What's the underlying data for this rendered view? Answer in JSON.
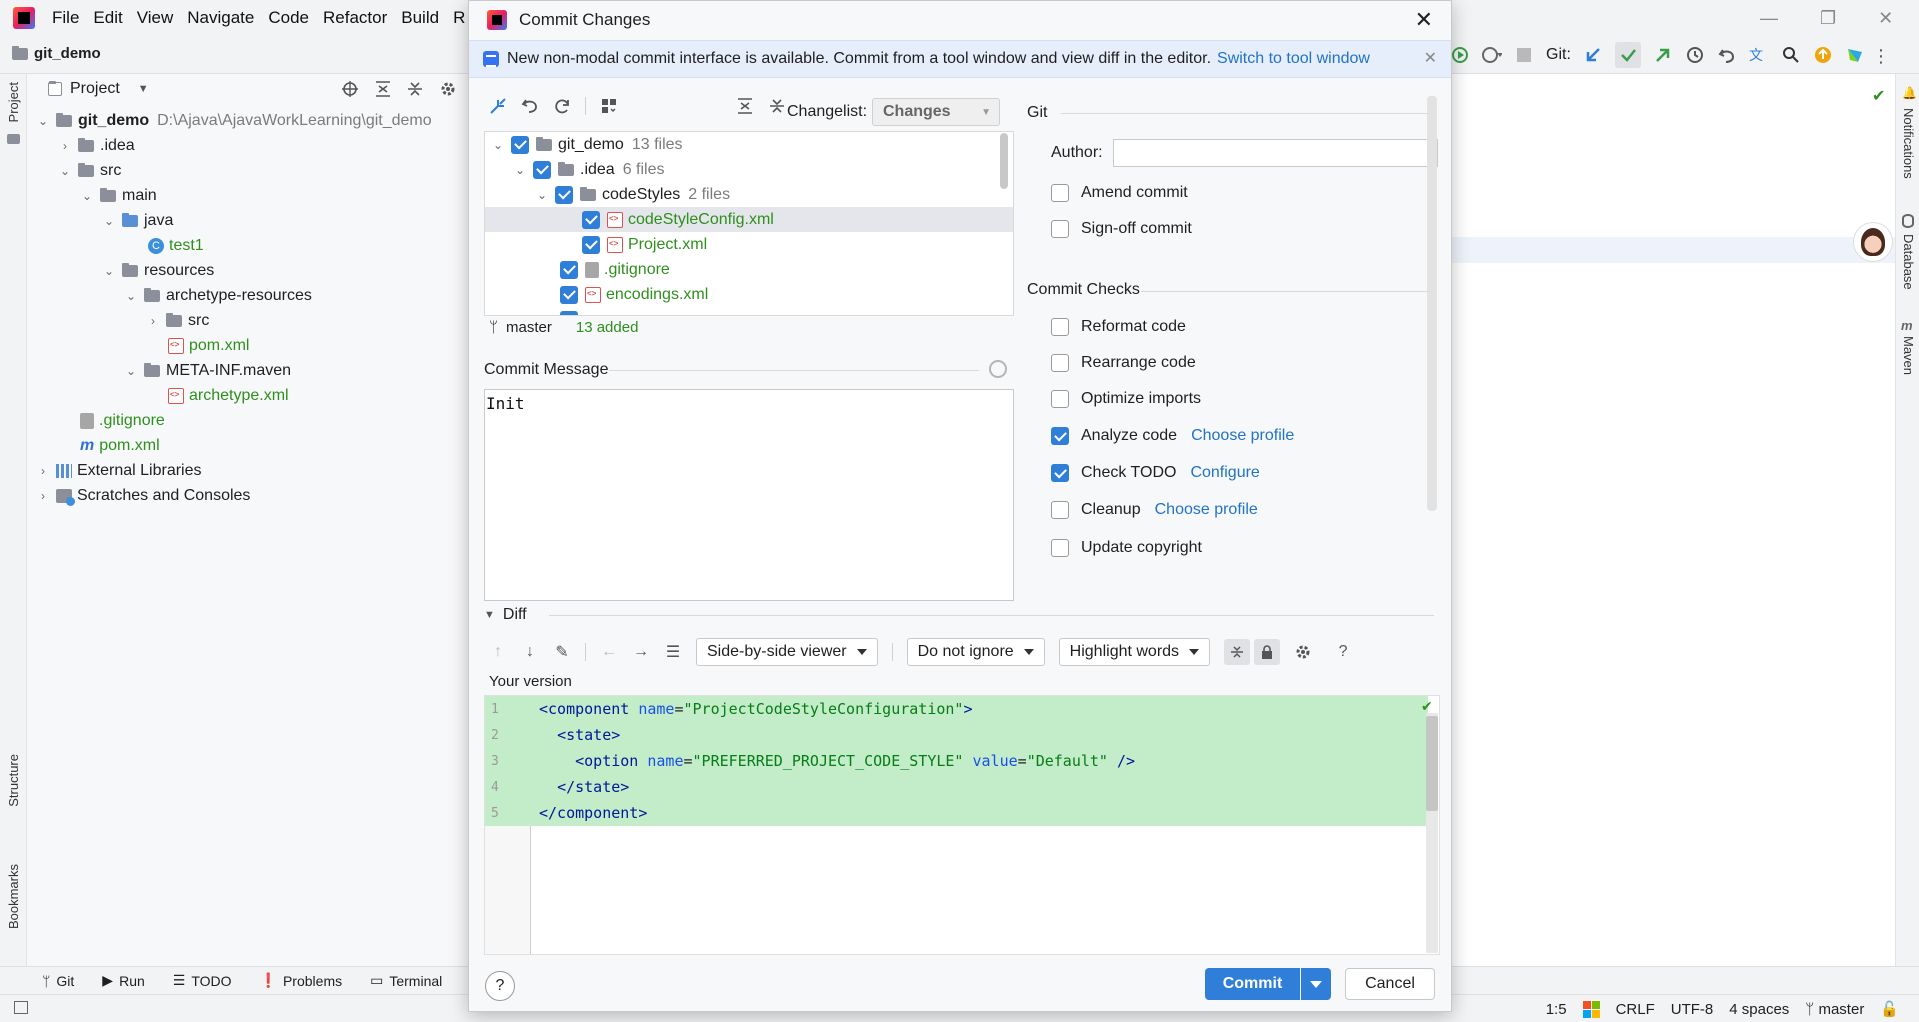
{
  "menu": [
    "File",
    "Edit",
    "View",
    "Navigate",
    "Code",
    "Refactor",
    "Build",
    "R"
  ],
  "navbar": {
    "project_name": "git_demo",
    "vcs_label": "Git:"
  },
  "left_stripe": {
    "project": "Project",
    "structure": "Structure",
    "bookmarks": "Bookmarks"
  },
  "right_stripe": {
    "notifications": "Notifications",
    "database": "Database",
    "maven": "Maven"
  },
  "project_panel": {
    "title": "Project",
    "root_name": "git_demo",
    "root_path": "D:\\Ajava\\AjavaWorkLearning\\git_demo",
    "items": {
      "idea": ".idea",
      "src": "src",
      "main": "main",
      "java": "java",
      "test1": "test1",
      "resources": "resources",
      "archetype_resources": "archetype-resources",
      "src2": "src",
      "pom_inner": "pom.xml",
      "meta_inf": "META-INF.maven",
      "archetype_xml": "archetype.xml",
      "gitignore": ".gitignore",
      "pom": "pom.xml",
      "external": "External Libraries",
      "scratches": "Scratches and Consoles"
    }
  },
  "dialog": {
    "title": "Commit Changes",
    "banner_text": "New non-modal commit interface is available. Commit from a tool window and view diff in the editor.",
    "banner_link": "Switch to tool window",
    "changelist_label": "Changelist:",
    "changelist_value": "Changes",
    "file_tree": {
      "root": "git_demo",
      "root_count": "13 files",
      "idea": ".idea",
      "idea_count": "6 files",
      "codestyles": "codeStyles",
      "codestyles_count": "2 files",
      "codestyleconfig": "codeStyleConfig.xml",
      "project_xml": "Project.xml",
      "gitignore": ".gitignore",
      "encodings": "encodings.xml"
    },
    "branch": "master",
    "added_summary": "13 added",
    "commit_message_label": "Commit Message",
    "commit_message": "Init",
    "git_section": "Git",
    "author_label": "Author:",
    "author_value": "",
    "amend_commit": "Amend commit",
    "signoff_commit": "Sign-off commit",
    "commit_checks": "Commit Checks",
    "checks": {
      "reformat": "Reformat code",
      "rearrange": "Rearrange code",
      "optimize": "Optimize imports",
      "analyze": "Analyze code",
      "analyze_link": "Choose profile",
      "todo": "Check TODO",
      "todo_link": "Configure",
      "cleanup": "Cleanup",
      "cleanup_link": "Choose profile",
      "copyright": "Update copyright"
    },
    "diff_label": "Diff",
    "viewer": "Side-by-side viewer",
    "ignore": "Do not ignore",
    "highlight": "Highlight words",
    "your_version": "Your version",
    "diff_lines": [
      "1",
      "2",
      "3",
      "4",
      "5"
    ],
    "commit_button": "Commit",
    "cancel_button": "Cancel",
    "help": "?"
  },
  "bottom_tabs": {
    "git": "Git",
    "run": "Run",
    "todo": "TODO",
    "problems": "Problems",
    "terminal": "Terminal"
  },
  "status": {
    "position": "1:5",
    "line_sep": "CRLF",
    "encoding": "UTF-8",
    "indent": "4 spaces",
    "branch": "master"
  },
  "colors": {
    "accent": "#2f7fd9",
    "added_green": "#2f8f1e",
    "diff_added_bg": "#c3ecc9",
    "link": "#2173c7"
  }
}
